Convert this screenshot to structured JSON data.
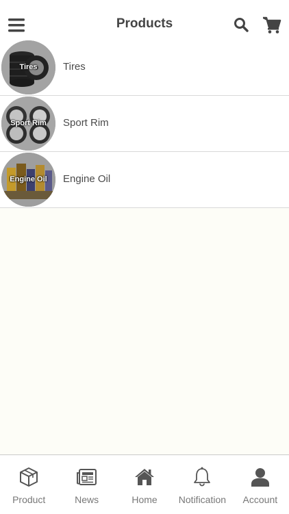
{
  "header": {
    "title": "Products"
  },
  "products": [
    {
      "thumb_label": "Tires",
      "label": "Tires"
    },
    {
      "thumb_label": "Sport Rim",
      "label": "Sport Rim"
    },
    {
      "thumb_label": "Engine Oil",
      "label": "Engine Oil"
    }
  ],
  "tabbar": {
    "items": [
      {
        "label": "Product",
        "icon": "box-icon"
      },
      {
        "label": "News",
        "icon": "newspaper-icon"
      },
      {
        "label": "Home",
        "icon": "home-icon"
      },
      {
        "label": "Notification",
        "icon": "bell-icon"
      },
      {
        "label": "Account",
        "icon": "user-icon"
      }
    ]
  },
  "colors": {
    "text": "#444444",
    "tab_icon": "#555555",
    "empty_area": "#fdfdf7"
  }
}
